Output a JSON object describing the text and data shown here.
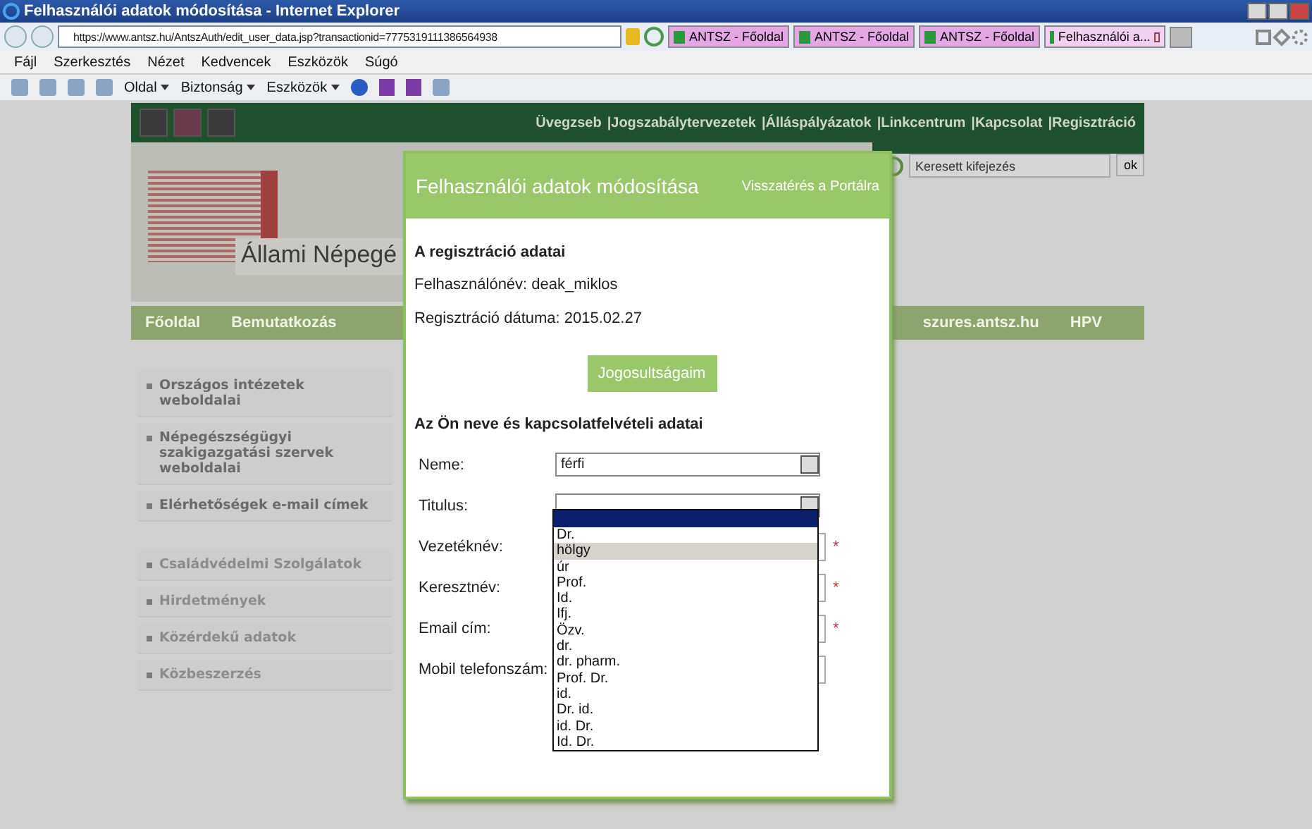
{
  "browser": {
    "title": "Felhasználói adatok módosítása - Internet Explorer",
    "url": "https://www.antsz.hu/AntszAuth/edit_user_data.jsp?transactionid=7775319111386564938",
    "tabs": [
      {
        "label": "ANTSZ - Főoldal",
        "selected": false
      },
      {
        "label": "ANTSZ - Főoldal",
        "selected": false
      },
      {
        "label": "ANTSZ - Főoldal",
        "selected": false
      },
      {
        "label": "Felhasználói a...",
        "selected": true
      }
    ],
    "menu": [
      "Fájl",
      "Szerkesztés",
      "Nézet",
      "Kedvencek",
      "Eszközök",
      "Súgó"
    ],
    "command_bar": [
      "Oldal",
      "Biztonság",
      "Eszközök"
    ]
  },
  "page": {
    "top_links": [
      "Üvegzseb",
      "|Jogszabálytervezetek",
      "|Álláspályázatok",
      "|Linkcentrum",
      "|Kapcsolat",
      "|Regisztráció"
    ],
    "search": {
      "placeholder": "Keresett kifejezés",
      "button": "ok"
    },
    "banner_title": "Állami Népegé",
    "nav": [
      "Főoldal",
      "Bemutatkozás",
      "szures.antsz.hu",
      "HPV"
    ],
    "sidebar": [
      "Országos intézetek weboldalai",
      "Népegészségügyi szakigazgatási szervek weboldalai",
      "Elérhetőségek e-mail címek",
      "Családvédelmi Szolgálatok",
      "Hirdetmények",
      "Közérdekű adatok",
      "Közbeszerzés"
    ]
  },
  "modal": {
    "title": "Felhasználói adatok módosítása",
    "back_link": "Visszatérés a Portálra",
    "section1_title": "A regisztráció adatai",
    "username_line": "Felhasználónév: deak_miklos",
    "date_line": "Regisztráció dátuma: 2015.02.27",
    "permissions_button": "Jogosultságaim",
    "section2_title": "Az Ön neve és kapcsolatfelvételi adatai",
    "fields": [
      {
        "label": "Neme:",
        "kind": "select",
        "value": "férfi"
      },
      {
        "label": "Titulus:",
        "kind": "select"
      },
      {
        "label": "Vezetéknév:",
        "kind": "text",
        "required_mark": "*"
      },
      {
        "label": "Keresztnév:",
        "kind": "text",
        "required_mark": "*"
      },
      {
        "label": "Email cím:",
        "kind": "text",
        "required_mark": "*"
      },
      {
        "label": "Mobil telefonszám:",
        "kind": "text"
      }
    ],
    "title_options": [
      {
        "selected": true,
        "hovered": false
      },
      {
        "label": "Dr.",
        "selected": false,
        "hovered": false
      },
      {
        "label": "hölgy",
        "selected": false,
        "hovered": true
      },
      {
        "label": "úr",
        "selected": false,
        "hovered": false
      },
      {
        "label": "Prof.",
        "selected": false,
        "hovered": false
      },
      {
        "label": "Id.",
        "selected": false,
        "hovered": false
      },
      {
        "label": "Ifj.",
        "selected": false,
        "hovered": false
      },
      {
        "label": "Özv.",
        "selected": false,
        "hovered": false
      },
      {
        "label": "dr.",
        "selected": false,
        "hovered": false
      },
      {
        "label": "dr. pharm.",
        "selected": false,
        "hovered": false
      },
      {
        "label": "Prof. Dr.",
        "selected": false,
        "hovered": false
      },
      {
        "label": "id.",
        "selected": false,
        "hovered": false
      },
      {
        "label": "Dr. id.",
        "selected": false,
        "hovered": false
      },
      {
        "label": "id. Dr.",
        "selected": false,
        "hovered": false
      },
      {
        "label": "Id. Dr.",
        "selected": false,
        "hovered": false
      }
    ]
  }
}
